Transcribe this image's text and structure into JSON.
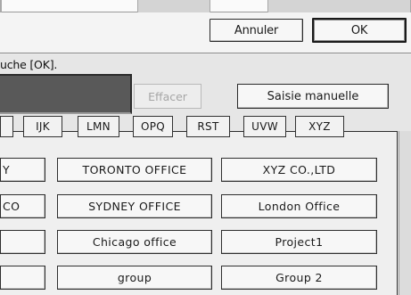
{
  "header": {
    "cancel_label": "Annuler",
    "ok_label": "OK"
  },
  "instruction": "uche [OK].",
  "actions": {
    "clear_label": "Effacer",
    "manual_label": "Saisie manuelle"
  },
  "index_tabs": [
    "",
    "IJK",
    "LMN",
    "OPQ",
    "RST",
    "UVW",
    "XYZ"
  ],
  "entries": {
    "row1": [
      "Y",
      "TORONTO OFFICE",
      "XYZ CO.,LTD"
    ],
    "row2": [
      "CO",
      "SYDNEY OFFICE",
      "London Office"
    ],
    "row3": [
      "",
      "Chicago office",
      "Project1"
    ],
    "row4": [
      "",
      "group",
      "Group 2"
    ]
  },
  "colors": {
    "dark_field": "#595959",
    "background": "#ececec",
    "disabled_text": "#a6a6a6"
  }
}
